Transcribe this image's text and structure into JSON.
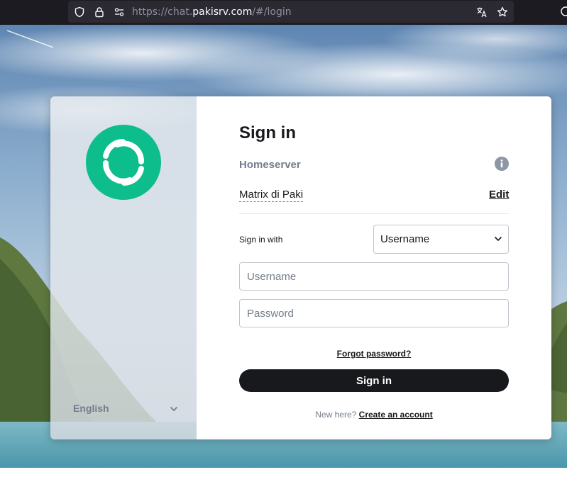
{
  "browser": {
    "url_prefix": "https://chat.",
    "url_host": "pakisrv.com",
    "url_suffix": "/#/login",
    "icons": [
      "shield-icon",
      "lock-icon",
      "permissions-icon",
      "translate-icon",
      "bookmark-star-icon"
    ]
  },
  "auth": {
    "title": "Sign in",
    "homeserver_label": "Homeserver",
    "homeserver_name": "Matrix di Paki",
    "edit_label": "Edit",
    "sign_in_with_label": "Sign in with",
    "method_selected": "Username",
    "username_placeholder": "Username",
    "password_placeholder": "Password",
    "forgot_label": "Forgot password?",
    "submit_label": "Sign in",
    "new_here_label": "New here?",
    "create_account_label": "Create an account"
  },
  "language": {
    "selected": "English"
  },
  "colors": {
    "brand": "#0dbd8b",
    "primary_button": "#17191c",
    "muted_text": "#737d8c"
  }
}
